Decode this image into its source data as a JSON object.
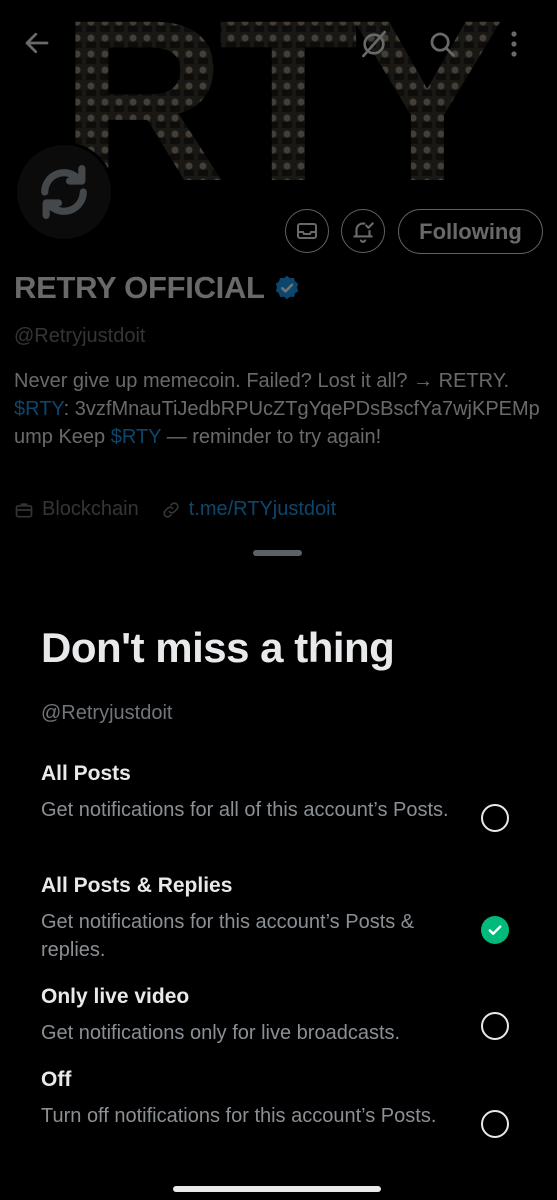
{
  "profile": {
    "display_name": "RETRY OFFICIAL",
    "handle": "@Retryjustdoit",
    "bio": {
      "part1": "Never give up memecoin.  Failed? Lost it all? → RETRY. ",
      "cashtag1": "$RTY",
      "part2": ": 3vzfMnauTiJedbRPUcZTgYqePDsBscfYa7wjKPEMpump  Keep ",
      "cashtag2": "$RTY",
      "part3": " — reminder to try again!"
    },
    "category": "Blockchain",
    "link": "t.me/RTYjustdoit",
    "banner_text": "RTY"
  },
  "topbar": {
    "back_icon": "arrow-left-icon",
    "hide_icon": "eye-off-icon",
    "search_icon": "search-icon",
    "more_icon": "more-vertical-icon"
  },
  "actions": {
    "message_icon": "envelope-icon",
    "notify_icon": "bell-check-icon",
    "following_label": "Following"
  },
  "sheet": {
    "title": "Don't miss a thing",
    "handle": "@Retryjustdoit",
    "options": [
      {
        "title": "All Posts",
        "description": "Get notifications for all of this account’s Posts.",
        "selected": false
      },
      {
        "title": "All Posts & Replies",
        "description": "Get notifications for this account’s Posts & replies.",
        "selected": true
      },
      {
        "title": "Only live video",
        "description": "Get notifications only for live broadcasts.",
        "selected": false
      },
      {
        "title": "Off",
        "description": "Turn off notifications for this account’s Posts.",
        "selected": false
      }
    ]
  },
  "colors": {
    "accent": "#1d9bf0",
    "selected": "#00ba7c",
    "background": "#000000"
  }
}
